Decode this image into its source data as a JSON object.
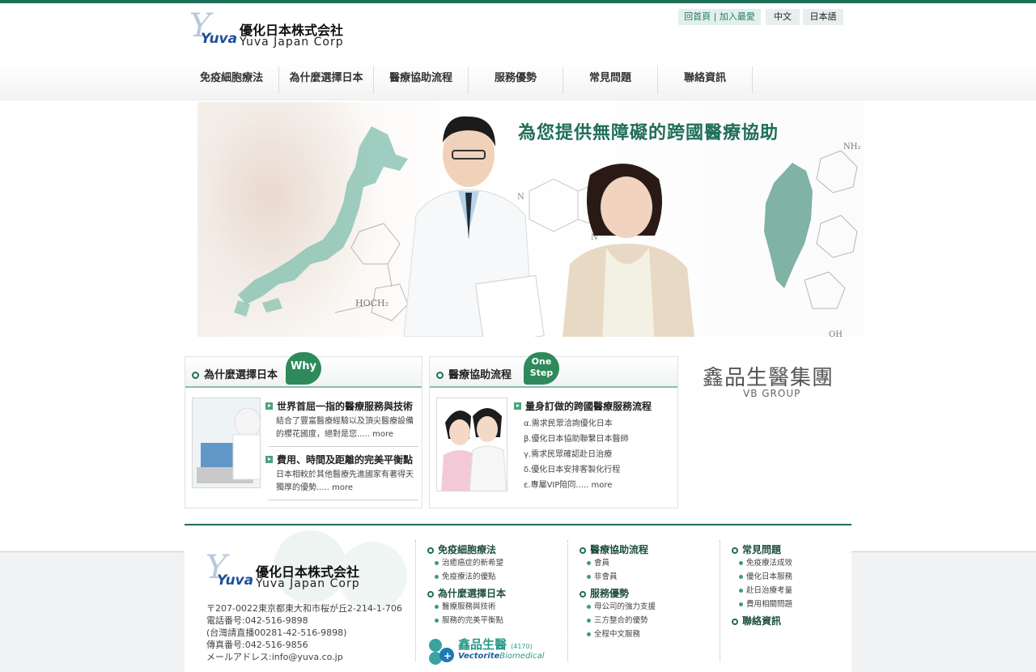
{
  "brand": {
    "mark": "Y",
    "yuva": "Yuva",
    "name_cn": "優化日本株式会社",
    "name_en": "Yuva Japan Corp"
  },
  "top_links": {
    "home": "回首頁",
    "sep": "|",
    "favorite": "加入最愛",
    "lang_zh": "中文",
    "lang_ja": "日本語"
  },
  "nav": {
    "items": [
      {
        "label": "免疫細胞療法"
      },
      {
        "label": "為什麼選擇日本"
      },
      {
        "label": "醫療協助流程"
      },
      {
        "label": "服務優勢"
      },
      {
        "label": "常見問題"
      },
      {
        "label": "聯絡資訊"
      }
    ]
  },
  "banner": {
    "headline": "為您提供無障礙的跨國醫療協助"
  },
  "why_box": {
    "title": "為什麼選擇日本",
    "badge": "Why",
    "items": [
      {
        "head": "世界首屈一指的醫療服務與技術",
        "desc_l1": "結合了豐富醫療經驗以及頂尖醫療設備",
        "desc_l2": "的櫻花國度，絕對是您.....",
        "more": "more"
      },
      {
        "head": "費用、時間及距離的完美平衡點",
        "desc_l1": "日本相較於其他醫療先進國家有著得天",
        "desc_l2": "獨厚的優勢.....",
        "more": "more"
      }
    ]
  },
  "flow_box": {
    "title": "醫療協助流程",
    "badge_l1": "One",
    "badge_l2": "Step",
    "head": "量身訂做的跨國醫療服務流程",
    "steps": [
      "α.需求民眾洽詢優化日本",
      "β.優化日本協助聯繫日本醫師",
      "γ.需求民眾確認赴日治療",
      "δ.優化日本安排客製化行程",
      "ε.專屬VIP陪同....."
    ],
    "more": "more"
  },
  "vb_group": {
    "cn": "鑫品生醫集團",
    "en": "VB GROUP"
  },
  "footer": {
    "address": [
      "〒207-0022東京都東大和市桜が丘2-214-1-706",
      "電話番号:042-516-9898",
      "(台灣請直播00281-42-516-9898)",
      "傳真番号:042-516-9856",
      "メールアドレス:info@yuva.co.jp"
    ],
    "col1": {
      "head1": "免疫細胞療法",
      "links1": [
        "治癒癌症的新希望",
        "免疫療法的優點"
      ],
      "head2": "為什麼選擇日本",
      "links2": [
        "醫療服務與技術",
        "服務的完美平衡點"
      ]
    },
    "col2": {
      "head1": "醫療協助流程",
      "links1": [
        "會員",
        "非會員"
      ],
      "head2": "服務優勢",
      "links2": [
        "母公司的強力支援",
        "三方整合的優勢",
        "全程中文服務"
      ]
    },
    "col3": {
      "head1": "常見問題",
      "links1": [
        "免疫療法成效",
        "優化日本服務",
        "赴日治療考量",
        "費用相關問題"
      ],
      "head2": "聯絡資訊"
    },
    "vb_bio": {
      "cn": "鑫品生醫",
      "code": "(4170)",
      "en": "Vectorite",
      "en2": "Biomedical"
    }
  },
  "colors": {
    "brand_green": "#1f6e58",
    "accent_green": "#2e8a5a",
    "logo_blue": "#1e4f9a"
  }
}
